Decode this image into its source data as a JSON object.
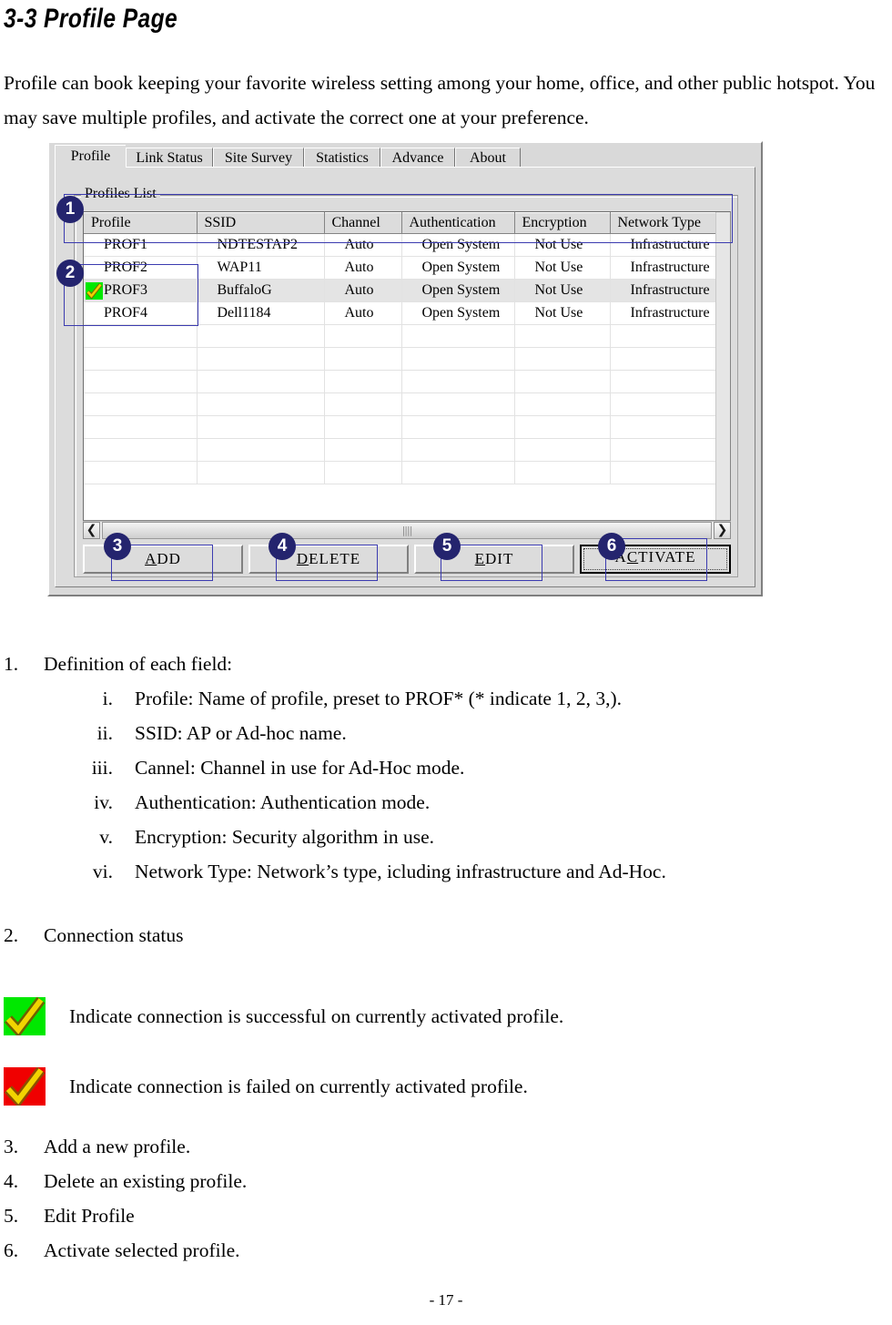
{
  "document": {
    "heading": "3-3 Profile Page",
    "intro": "Profile can book keeping your favorite wireless setting among your home, office, and other public hotspot. You may save multiple profiles, and activate the correct one at your preference.",
    "footer": "- 17 -"
  },
  "dialog": {
    "tabs": [
      {
        "label": "Profile",
        "active": true
      },
      {
        "label": "Link Status",
        "active": false
      },
      {
        "label": "Site Survey",
        "active": false
      },
      {
        "label": "Statistics",
        "active": false
      },
      {
        "label": "Advance",
        "active": false
      },
      {
        "label": "About",
        "active": false
      }
    ],
    "group_title": "Profiles List",
    "table": {
      "columns": [
        "Profile",
        "SSID",
        "Channel",
        "Authentication",
        "Encryption",
        "Network Type"
      ],
      "rows": [
        {
          "profile": "PROF1",
          "ssid": "NDTESTAP2",
          "channel": "Auto",
          "authentication": "Open System",
          "encryption": "Not Use",
          "network_type": "Infrastructure",
          "selected": false,
          "status_icon": ""
        },
        {
          "profile": "PROF2",
          "ssid": "WAP11",
          "channel": "Auto",
          "authentication": "Open System",
          "encryption": "Not Use",
          "network_type": "Infrastructure",
          "selected": false,
          "status_icon": ""
        },
        {
          "profile": "PROF3",
          "ssid": "BuffaloG",
          "channel": "Auto",
          "authentication": "Open System",
          "encryption": "Not Use",
          "network_type": "Infrastructure",
          "selected": true,
          "status_icon": "green-check-icon"
        },
        {
          "profile": "PROF4",
          "ssid": "Dell1184",
          "channel": "Auto",
          "authentication": "Open System",
          "encryption": "Not Use",
          "network_type": "Infrastructure",
          "selected": false,
          "status_icon": ""
        }
      ],
      "empty_row_count": 7
    },
    "scrollbar": {
      "left_arrow": "❮",
      "right_arrow": "❯",
      "thumb_grip": "||||"
    },
    "buttons": [
      {
        "name": "add",
        "label": "ADD",
        "accel": "A",
        "default": false
      },
      {
        "name": "delete",
        "label": "DELETE",
        "accel": "D",
        "default": false
      },
      {
        "name": "edit",
        "label": "EDIT",
        "accel": "E",
        "default": false
      },
      {
        "name": "activate",
        "label": "ACTIVATE",
        "accel": "C",
        "default": true
      }
    ],
    "callouts": [
      "1",
      "2",
      "3",
      "4",
      "5",
      "6"
    ],
    "colors": {
      "annotation": "#3b3bb0",
      "callout_fill": "#24246e",
      "dialog_face": "#dcdcdc",
      "selected_row": "#e4e4e4",
      "status_ok": "#00e800",
      "status_fail": "#f00000",
      "check_mark": "#e8c800"
    }
  },
  "notes": {
    "item1": {
      "number": "1.",
      "text": "Definition of each field:"
    },
    "fields": [
      {
        "marker": "i.",
        "text": "Profile: Name of profile, preset to PROF* (* indicate 1, 2, 3,)."
      },
      {
        "marker": "ii.",
        "text": "SSID: AP or Ad-hoc name."
      },
      {
        "marker": "iii.",
        "text": "Cannel: Channel in use for Ad-Hoc mode."
      },
      {
        "marker": "iv.",
        "text": "Authentication: Authentication mode."
      },
      {
        "marker": "v.",
        "text": "Encryption: Security algorithm in use."
      },
      {
        "marker": "vi.",
        "text": "Network Type: Network’s type, icluding infrastructure and Ad-Hoc."
      }
    ],
    "item2": {
      "number": "2.",
      "text": "Connection status"
    },
    "status_legend": [
      {
        "icon": "green-check-icon",
        "text": "Indicate connection is successful on currently activated profile."
      },
      {
        "icon": "red-check-icon",
        "text": "Indicate connection is failed on currently activated profile."
      }
    ],
    "actions": [
      {
        "number": "3.",
        "text": "Add a new profile."
      },
      {
        "number": "4.",
        "text": "Delete an existing profile."
      },
      {
        "number": "5.",
        "text": "Edit Profile"
      },
      {
        "number": "6.",
        "text": "Activate selected profile."
      }
    ]
  }
}
